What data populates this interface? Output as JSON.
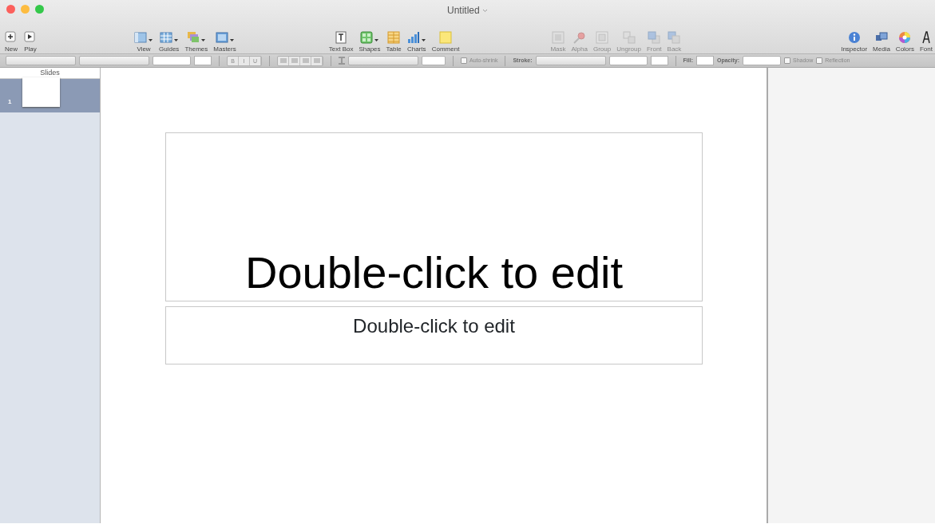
{
  "window": {
    "title": "Untitled"
  },
  "toolbar": [
    {
      "group": [
        {
          "label": "New",
          "disabled": false
        },
        {
          "label": "Play",
          "disabled": false
        }
      ]
    },
    {
      "group": [
        {
          "label": "View",
          "disabled": false
        },
        {
          "label": "Guides",
          "disabled": false
        },
        {
          "label": "Themes",
          "disabled": false
        },
        {
          "label": "Masters",
          "disabled": false
        }
      ]
    },
    {
      "group": [
        {
          "label": "Text Box",
          "disabled": false
        },
        {
          "label": "Shapes",
          "disabled": false
        },
        {
          "label": "Table",
          "disabled": false
        },
        {
          "label": "Charts",
          "disabled": false
        },
        {
          "label": "Comment",
          "disabled": false
        }
      ]
    },
    {
      "group": [
        {
          "label": "Mask",
          "disabled": true
        },
        {
          "label": "Alpha",
          "disabled": true
        },
        {
          "label": "Group",
          "disabled": true
        },
        {
          "label": "Ungroup",
          "disabled": true
        },
        {
          "label": "Front",
          "disabled": true
        },
        {
          "label": "Back",
          "disabled": true
        }
      ]
    },
    {
      "group": [
        {
          "label": "Inspector",
          "disabled": false
        },
        {
          "label": "Media",
          "disabled": false
        },
        {
          "label": "Colors",
          "disabled": false
        },
        {
          "label": "Font",
          "disabled": false
        }
      ]
    }
  ],
  "format_bar": [
    {
      "kind": "select"
    },
    {
      "kind": "select"
    },
    {
      "kind": "combo"
    },
    {
      "kind": "field"
    },
    {
      "kind": "sep"
    },
    {
      "kind": "styles",
      "labels": [
        "B",
        "I",
        "U"
      ]
    },
    {
      "kind": "sep"
    },
    {
      "kind": "align"
    },
    {
      "kind": "sep"
    },
    {
      "kind": "spacing"
    },
    {
      "kind": "select"
    },
    {
      "kind": "columns"
    },
    {
      "kind": "sep"
    },
    {
      "kind": "checkbox",
      "label": "Auto-shrink",
      "checked": false
    },
    {
      "kind": "sep"
    },
    {
      "kind": "label",
      "label": "Stroke:"
    },
    {
      "kind": "select"
    },
    {
      "kind": "combo"
    },
    {
      "kind": "field"
    },
    {
      "kind": "sep"
    },
    {
      "kind": "label",
      "label": "Fill:"
    },
    {
      "kind": "field"
    },
    {
      "kind": "label",
      "label": "Opacity:"
    },
    {
      "kind": "combo"
    },
    {
      "kind": "checkbox",
      "label": "Shadow",
      "checked": false
    },
    {
      "kind": "checkbox",
      "label": "Reflection",
      "checked": false
    }
  ],
  "sidebar": {
    "title": "Slides",
    "slides": [
      {
        "number": "1",
        "selected": true
      }
    ]
  },
  "slide": {
    "title": "Double-click to edit",
    "subtitle": "Double-click to edit"
  }
}
